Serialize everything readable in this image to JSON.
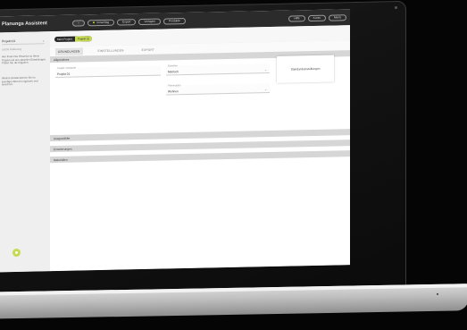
{
  "app": {
    "title": "Planungs Assistent"
  },
  "topnav": {
    "items": [
      {
        "label": "○"
      },
      {
        "label": "Vorschlag"
      },
      {
        "label": "Export"
      },
      {
        "label": "Vorlagen"
      },
      {
        "label": "Produkte"
      }
    ],
    "right": [
      {
        "label": "Hilfe"
      },
      {
        "label": "Konto"
      },
      {
        "label": "Menü"
      }
    ]
  },
  "sidebar": {
    "project_value": "Projekt 01",
    "subtitle": "Letzte Änderung",
    "text_1": "Hier finden Sie Hinweise zu Ihrem Projekt und den aktuellen Einstellungen. Prüfen Sie die Angaben.",
    "text_2": "Weitere Details können Sie im jeweiligen Bereich ergänzen und speichern."
  },
  "project_bar": {
    "tag_label": "Mein Projekt",
    "tag_value": "Projekt 01"
  },
  "tabs": [
    "GRUNDLAGEN",
    "EINSTELLUNGEN",
    "EXPORT"
  ],
  "sections": {
    "general": "Allgemeines",
    "products": "Ausgewählte",
    "extensions": "Erweiterungen",
    "materials": "Materialien"
  },
  "fields": {
    "project_name": {
      "label": "Projekt / Gebäude",
      "value": "Projekt 01"
    },
    "unit": {
      "label": "Einheiten",
      "value": "Metrisch"
    },
    "type": {
      "label": "Planungstyp",
      "value": "Wohnen"
    }
  },
  "card": {
    "label": "Standardeinstellungen"
  }
}
